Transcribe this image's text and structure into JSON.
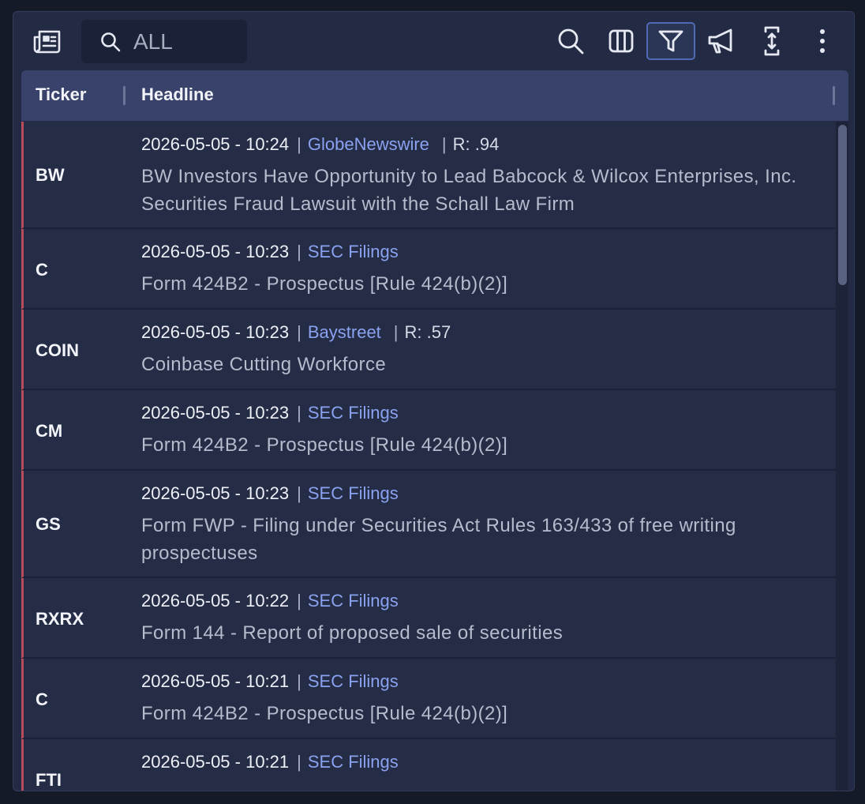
{
  "toolbar": {
    "search_placeholder": "ALL",
    "icons": [
      "newspaper-icon",
      "search-icon",
      "columns-icon",
      "filter-icon",
      "megaphone-icon",
      "expand-icon",
      "more-vertical-icon"
    ]
  },
  "table": {
    "columns": [
      "Ticker",
      "Headline"
    ],
    "rows": [
      {
        "ticker": "BW",
        "datetime": "2026-05-05 - 10:24",
        "source": "GlobeNewswire",
        "relevance": "R: .94",
        "headline": "BW Investors Have Opportunity to Lead Babcock & Wilcox Enterprises, Inc. Securities Fraud Lawsuit with the Schall Law Firm"
      },
      {
        "ticker": "C",
        "datetime": "2026-05-05 - 10:23",
        "source": "SEC Filings",
        "relevance": "",
        "headline": "Form 424B2 - Prospectus [Rule 424(b)(2)]"
      },
      {
        "ticker": "COIN",
        "datetime": "2026-05-05 - 10:23",
        "source": "Baystreet",
        "relevance": "R: .57",
        "headline": "Coinbase Cutting Workforce"
      },
      {
        "ticker": "CM",
        "datetime": "2026-05-05 - 10:23",
        "source": "SEC Filings",
        "relevance": "",
        "headline": "Form 424B2 - Prospectus [Rule 424(b)(2)]"
      },
      {
        "ticker": "GS",
        "datetime": "2026-05-05 - 10:23",
        "source": "SEC Filings",
        "relevance": "",
        "headline": "Form FWP - Filing under Securities Act Rules 163/433 of free writing prospectuses"
      },
      {
        "ticker": "RXRX",
        "datetime": "2026-05-05 - 10:22",
        "source": "SEC Filings",
        "relevance": "",
        "headline": "Form 144 - Report of proposed sale of securities"
      },
      {
        "ticker": "C",
        "datetime": "2026-05-05 - 10:21",
        "source": "SEC Filings",
        "relevance": "",
        "headline": "Form 424B2 - Prospectus [Rule 424(b)(2)]"
      },
      {
        "ticker": "FTI",
        "datetime": "2026-05-05 - 10:21",
        "source": "SEC Filings",
        "relevance": "",
        "headline": ""
      }
    ]
  },
  "colors": {
    "accent_red": "#b84c5c",
    "source_link": "#8aa2ef",
    "panel_bg": "#232a43",
    "header_bg": "#38426a"
  }
}
